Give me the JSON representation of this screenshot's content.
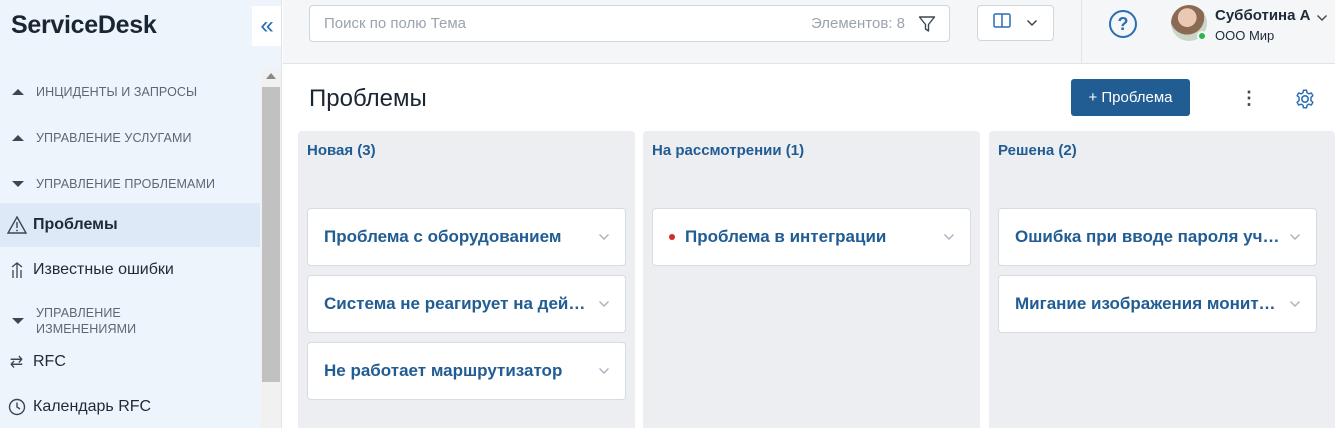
{
  "app": {
    "brand": "ServiceDesk",
    "collapse_icon": "double-chevron-left-icon"
  },
  "sidebar": {
    "items": [
      {
        "type": "section",
        "label": "ИНЦИДЕНТЫ И ЗАПРОСЫ",
        "expanded": false
      },
      {
        "type": "section",
        "label": "УПРАВЛЕНИЕ УСЛУГАМИ",
        "expanded": false
      },
      {
        "type": "section",
        "label": "УПРАВЛЕНИЕ ПРОБЛЕМАМИ",
        "expanded": true
      },
      {
        "type": "link",
        "label": "Проблемы",
        "icon": "warning-triangle-icon",
        "active": true
      },
      {
        "type": "link",
        "label": "Известные ошибки",
        "icon": "known-errors-icon",
        "active": false
      },
      {
        "type": "section",
        "label": "УПРАВЛЕНИЕ ИЗМЕНЕНИЯМИ",
        "expanded": true
      },
      {
        "type": "link",
        "label": "RFC",
        "icon": "swap-arrows-icon",
        "active": false
      },
      {
        "type": "link",
        "label": "Календарь RFC",
        "icon": "clock-icon",
        "active": false
      }
    ]
  },
  "topbar": {
    "search_placeholder": "Поиск по полю Тема",
    "items_count": "Элементов: 8",
    "user_name": "Субботина А",
    "user_org": "ООО Мир",
    "help_label": "?"
  },
  "page": {
    "title": "Проблемы",
    "add_button": "+ Проблема"
  },
  "board": {
    "columns": [
      {
        "title": "Новая (3)",
        "cards": [
          {
            "title": "Проблема с оборудованием",
            "flag": false
          },
          {
            "title": "Система не реагирует на действия",
            "flag": false
          },
          {
            "title": "Не работает маршрутизатор",
            "flag": false
          }
        ]
      },
      {
        "title": "На рассмотрении (1)",
        "cards": [
          {
            "title": "Проблема в интеграции",
            "flag": true
          }
        ]
      },
      {
        "title": "Решена (2)",
        "cards": [
          {
            "title": "Ошибка при вводе пароля учетной записи",
            "flag": false
          },
          {
            "title": "Мигание изображения монитора",
            "flag": false
          }
        ]
      }
    ]
  },
  "colors": {
    "accent": "#215c93",
    "sidebar_bg": "#eef4fb",
    "active_item_bg": "#dde9f6",
    "column_bg": "#eceef1",
    "flag_red": "#d42b2b",
    "online_green": "#2fb34a"
  }
}
